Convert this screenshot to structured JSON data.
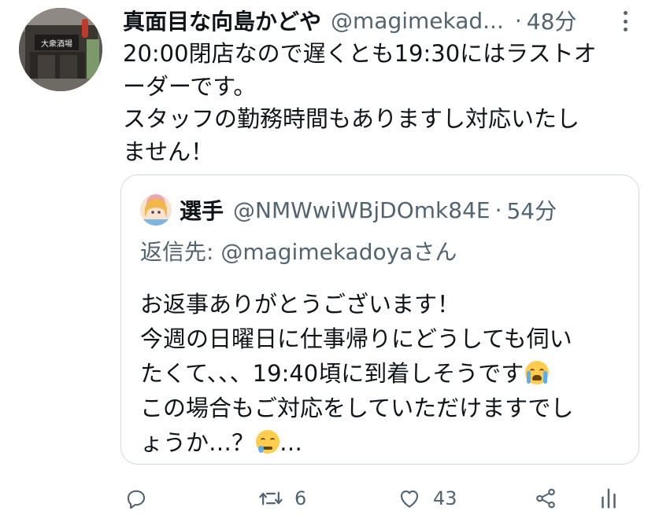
{
  "tweet": {
    "author_name": "真面目な向島かどや",
    "handle": "@magimekad...",
    "separator": "·",
    "time": "48分",
    "text_lines": [
      "20:00閉店なので遅くとも19:30にはラストオ",
      "ーダーです。",
      "スタッフの勤務時間もありますし対応いたし",
      "ません！"
    ],
    "avatar_sign_text": "大衆酒場"
  },
  "quote": {
    "author_name": "選手",
    "handle": "@NMWwiWBjDOmk84E",
    "separator": "·",
    "time": "54分",
    "reply_prefix": "返信先: ",
    "reply_mention": "@magimekadoya",
    "reply_suffix": "さん",
    "text_lines": [
      "お返事ありがとうございます！",
      "今週の日曜日に仕事帰りにどうしても伺い",
      "たくて、、、19:40頃に到着しそうです",
      "この場合もご対応をしていただけますでし",
      "ょうか…？"
    ],
    "trailing_ellipsis": "…",
    "emojis": [
      "loudly-crying-face-icon",
      "sad-but-relieved-face-icon"
    ]
  },
  "actions": {
    "reply_count": "",
    "retweet_count": "6",
    "like_count": "43",
    "share_count": "",
    "analytics_count": ""
  },
  "colors": {
    "text": "#0f1419",
    "secondary": "#536471",
    "border": "#cfd9de"
  }
}
